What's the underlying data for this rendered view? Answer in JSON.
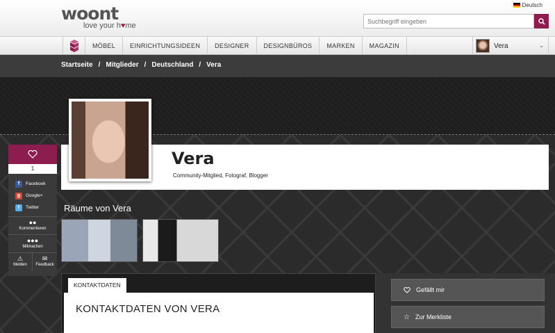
{
  "header": {
    "logo_word": "woont",
    "logo_tag_pre": "love your h",
    "logo_tag_heart": "♥",
    "logo_tag_post": "me",
    "language": "Deutsch",
    "search_placeholder": "Suchbegriff eingeben"
  },
  "nav": {
    "items": [
      "MÖBEL",
      "EINRICHTUNGSIDEEN",
      "DESIGNER",
      "DESIGNBÜROS",
      "MARKEN",
      "MAGAZIN"
    ],
    "user_name": "Vera"
  },
  "breadcrumb": [
    "Startseite",
    "/",
    "Mitglieder",
    "/",
    "Deutschland",
    "/",
    "Vera"
  ],
  "profile": {
    "name": "Vera",
    "roles": "Community-Mitglied, Fotograf, Blogger"
  },
  "share": {
    "like_count": "1",
    "links": [
      "Facebook",
      "Google+",
      "Twitter"
    ],
    "comments": "Kommentieren",
    "join": "Mitmachen",
    "report": "Melden",
    "feedback": "Feedback"
  },
  "rooms": {
    "title": "Räume von Vera"
  },
  "content": {
    "tab": "KONTAKTDATEN",
    "heading": "KONTAKTDATEN VON VERA"
  },
  "actions": {
    "like": "Gefällt mir",
    "wishlist": "Zur Merkliste"
  },
  "colors": {
    "accent": "#8c1d4e",
    "dark": "#2b2b2b"
  }
}
